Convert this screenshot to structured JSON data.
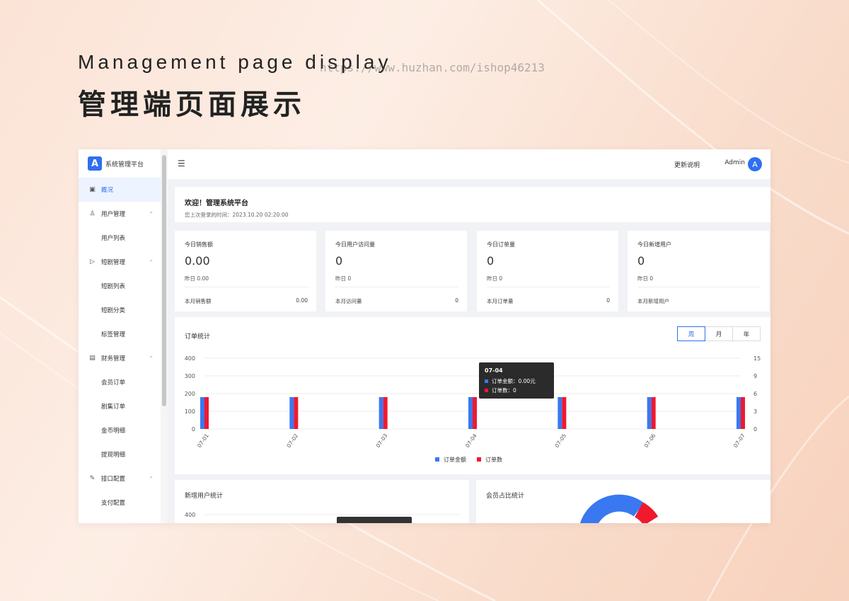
{
  "banner": {
    "title_en": "Management page display",
    "title_cn": "管理端页面展示",
    "watermark": "https://www.huzhan.com/ishop46213"
  },
  "sidebar": {
    "logo_letter": "A",
    "app_name": "系统管理平台",
    "items": [
      {
        "label": "概况",
        "icon": "dashboard-icon",
        "active": true
      },
      {
        "label": "用户管理",
        "icon": "user-icon",
        "expandable": true
      },
      {
        "label": "用户列表",
        "sub": true
      },
      {
        "label": "短剧管理",
        "icon": "play-icon",
        "expandable": true
      },
      {
        "label": "短剧列表",
        "sub": true
      },
      {
        "label": "短剧分类",
        "sub": true
      },
      {
        "label": "标签管理",
        "sub": true
      },
      {
        "label": "财务管理",
        "icon": "finance-icon",
        "expandable": true
      },
      {
        "label": "会员订单",
        "sub": true
      },
      {
        "label": "剧集订单",
        "sub": true
      },
      {
        "label": "金币明细",
        "sub": true
      },
      {
        "label": "提现明细",
        "sub": true
      },
      {
        "label": "接口配置",
        "icon": "api-icon",
        "expandable": true
      },
      {
        "label": "支付配置",
        "sub": true
      }
    ]
  },
  "topbar": {
    "update_label": "更新说明",
    "user_name": "Admin",
    "avatar_letter": "A"
  },
  "welcome": {
    "title": "欢迎！管理系统平台",
    "last_login": "您上次登录的时间：2023.10.20 02:20:00"
  },
  "stats": [
    {
      "label": "今日销售额",
      "value": "0.00",
      "yesterday": "昨日  0.00",
      "month_label": "本月销售额",
      "month_value": "0.00"
    },
    {
      "label": "今日用户访问量",
      "value": "0",
      "yesterday": "昨日  0",
      "month_label": "本月访问量",
      "month_value": "0"
    },
    {
      "label": "今日订单量",
      "value": "0",
      "yesterday": "昨日  0",
      "month_label": "本月订单量",
      "month_value": "0"
    },
    {
      "label": "今日新增用户",
      "value": "0",
      "yesterday": "昨日  0",
      "month_label": "本月新增用户",
      "month_value": ""
    }
  ],
  "order_chart": {
    "title": "订单统计",
    "periods": [
      "周",
      "月",
      "年"
    ],
    "active_period": "周"
  },
  "tooltip": {
    "date": "07-04",
    "amount_line": "订单金额：0.00元",
    "count_line": "订单数：0"
  },
  "chart_data": {
    "type": "bar",
    "categories": [
      "07-01",
      "07-02",
      "07-03",
      "07-04",
      "07-05",
      "07-06",
      "07-07"
    ],
    "series": [
      {
        "name": "订单金额",
        "values": [
          180,
          180,
          180,
          180,
          180,
          180,
          180
        ],
        "color": "#3a78f2",
        "axis": "left"
      },
      {
        "name": "订单数",
        "values": [
          6.75,
          6.75,
          6.75,
          6.75,
          6.75,
          6.75,
          6.75
        ],
        "color": "#f0192e",
        "axis": "right"
      }
    ],
    "y_left_ticks": [
      "400",
      "300",
      "200",
      "100",
      "0"
    ],
    "y_right_ticks": [
      "15",
      "9",
      "6",
      "3",
      "0"
    ],
    "ylim_left": [
      0,
      400
    ],
    "ylim_right": [
      0,
      15
    ],
    "grid": true,
    "legend_position": "bottom"
  },
  "new_users": {
    "title": "新增用户统计",
    "first_tick": "400"
  },
  "member_ratio": {
    "title": "会员占比统计"
  }
}
